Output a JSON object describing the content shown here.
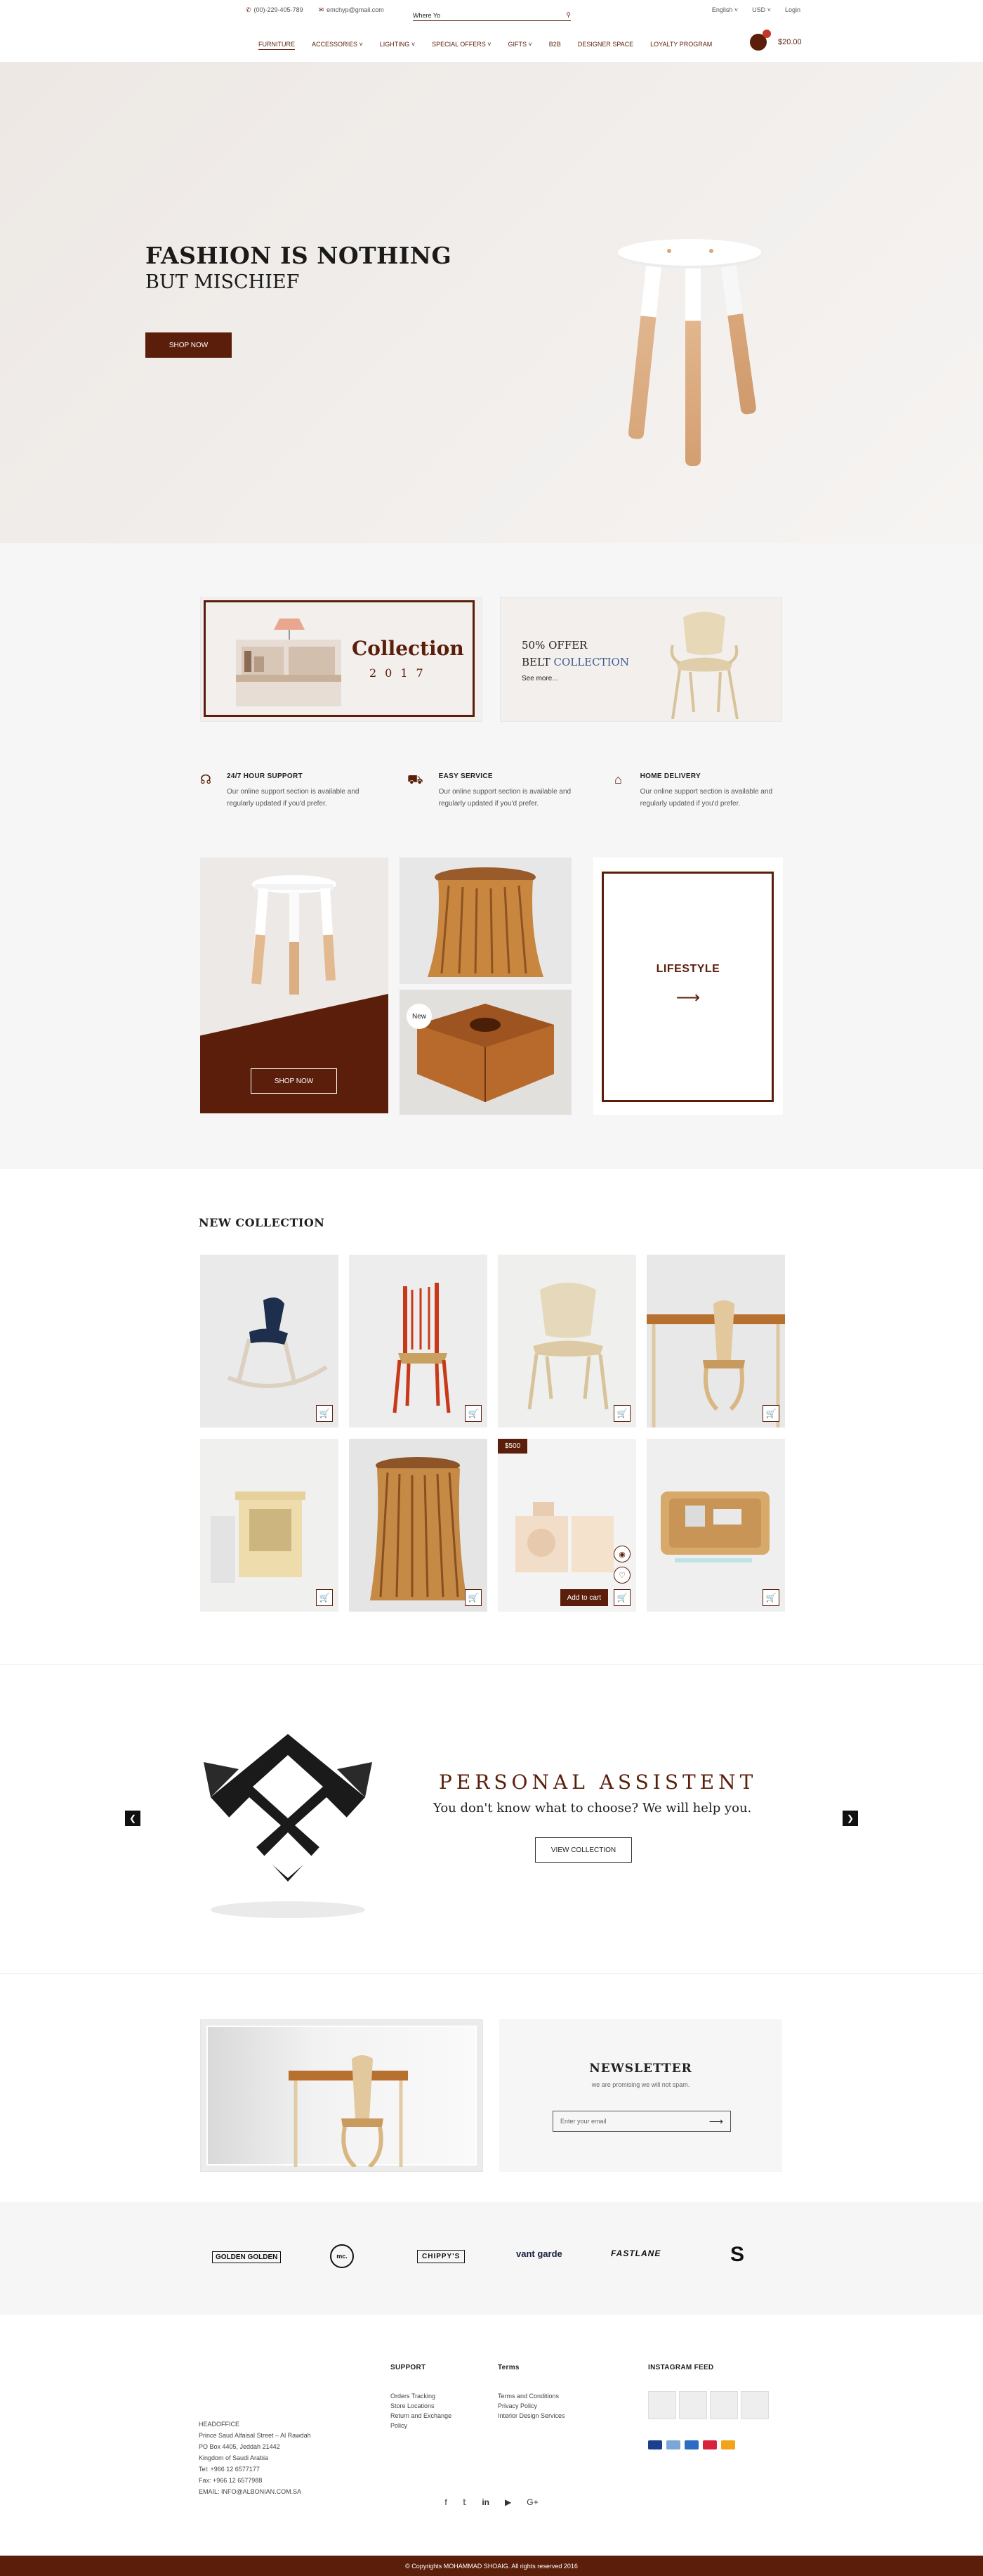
{
  "header": {
    "phone": "(00)-229-405-789",
    "email": "emchyp@gmail.com",
    "search_placeholder": "Where Yo",
    "language": "English",
    "currency": "USD",
    "login": "Login",
    "cart_total": "$20.00",
    "nav": [
      {
        "label": "FURNITURE",
        "active": true,
        "has_dropdown": false
      },
      {
        "label": "ACCESSORIES",
        "active": false,
        "has_dropdown": true
      },
      {
        "label": "LIGHTING",
        "active": false,
        "has_dropdown": true
      },
      {
        "label": "SPECIAL OFFERS",
        "active": false,
        "has_dropdown": true
      },
      {
        "label": "GIFTS",
        "active": false,
        "has_dropdown": true
      },
      {
        "label": "B2B",
        "active": false,
        "has_dropdown": false
      },
      {
        "label": "DESIGNER SPACE",
        "active": false,
        "has_dropdown": false
      },
      {
        "label": "LOYALTY PROGRAM",
        "active": false,
        "has_dropdown": false
      }
    ]
  },
  "hero": {
    "title": "FASHION IS NOTHING",
    "subtitle": "BUT MISCHIEF",
    "button": "SHOP NOW"
  },
  "promo": {
    "collection_title": "Collection",
    "collection_year": "2017",
    "offer_line1": "50% OFFER",
    "offer_line2_a": "BELT ",
    "offer_line2_b": "COLLECTION",
    "see_more": "See more..."
  },
  "features": [
    {
      "title": "24/7 HOUR SUPPORT",
      "text": "Our online support section is available and regularly updated if you'd prefer.",
      "icon": "headset-icon"
    },
    {
      "title": "EASY SERVICE",
      "text": "Our online support section is available and regularly updated if you'd prefer.",
      "icon": "truck-icon"
    },
    {
      "title": "HOME DELIVERY",
      "text": "Our online support section is available and regularly updated if you'd prefer.",
      "icon": "home-icon"
    }
  ],
  "tiles": {
    "shop_now": "SHOP NOW",
    "new_badge": "New",
    "lifestyle": "LIFESTYLE"
  },
  "new_collection": {
    "title": "NEW COLLECTION",
    "price_tag": "$500",
    "add_to_cart": "Add to cart"
  },
  "assistant": {
    "title": "PERSONAL ASSISTENT",
    "subtitle": "You don't know what to choose? We will help you.",
    "button": "VIEW COLLECTION"
  },
  "newsletter": {
    "title": "NEWSLETTER",
    "subtitle": "we are promising we will not spam.",
    "placeholder": "Enter your email"
  },
  "brands": [
    "GOLDEN GOLDEN",
    "mc.",
    "CHIPPY'S",
    "vant garde",
    "FASTLANE",
    "S"
  ],
  "footer": {
    "support_title": "SUPPORT",
    "support_links": [
      "Orders Tracking",
      "Store Locations",
      "Return and Exchange Policy"
    ],
    "terms_title": "Terms",
    "terms_links": [
      "Terms and Conditions",
      "Privacy Policy",
      "Interior Design Services"
    ],
    "instagram_title": "INSTAGRAM FEED",
    "address": [
      "HEADOFFICE",
      "Prince Saud Alfaisal Street – Al Rawdah",
      "PO Box 4405, Jeddah 21442",
      "Kingdom of Saudi Arabia",
      "Tel: +966 12 6577177",
      "Fax: +966 12 6577988",
      "EMAIL: INFO@ALBONIAN.COM.SA"
    ],
    "copyright": "© Copyrights MOHAMMAD SHOAIG. All rights reserved 2016"
  },
  "colors": {
    "brand": "#5a1e0a",
    "accent_blue": "#3c5d8f"
  }
}
